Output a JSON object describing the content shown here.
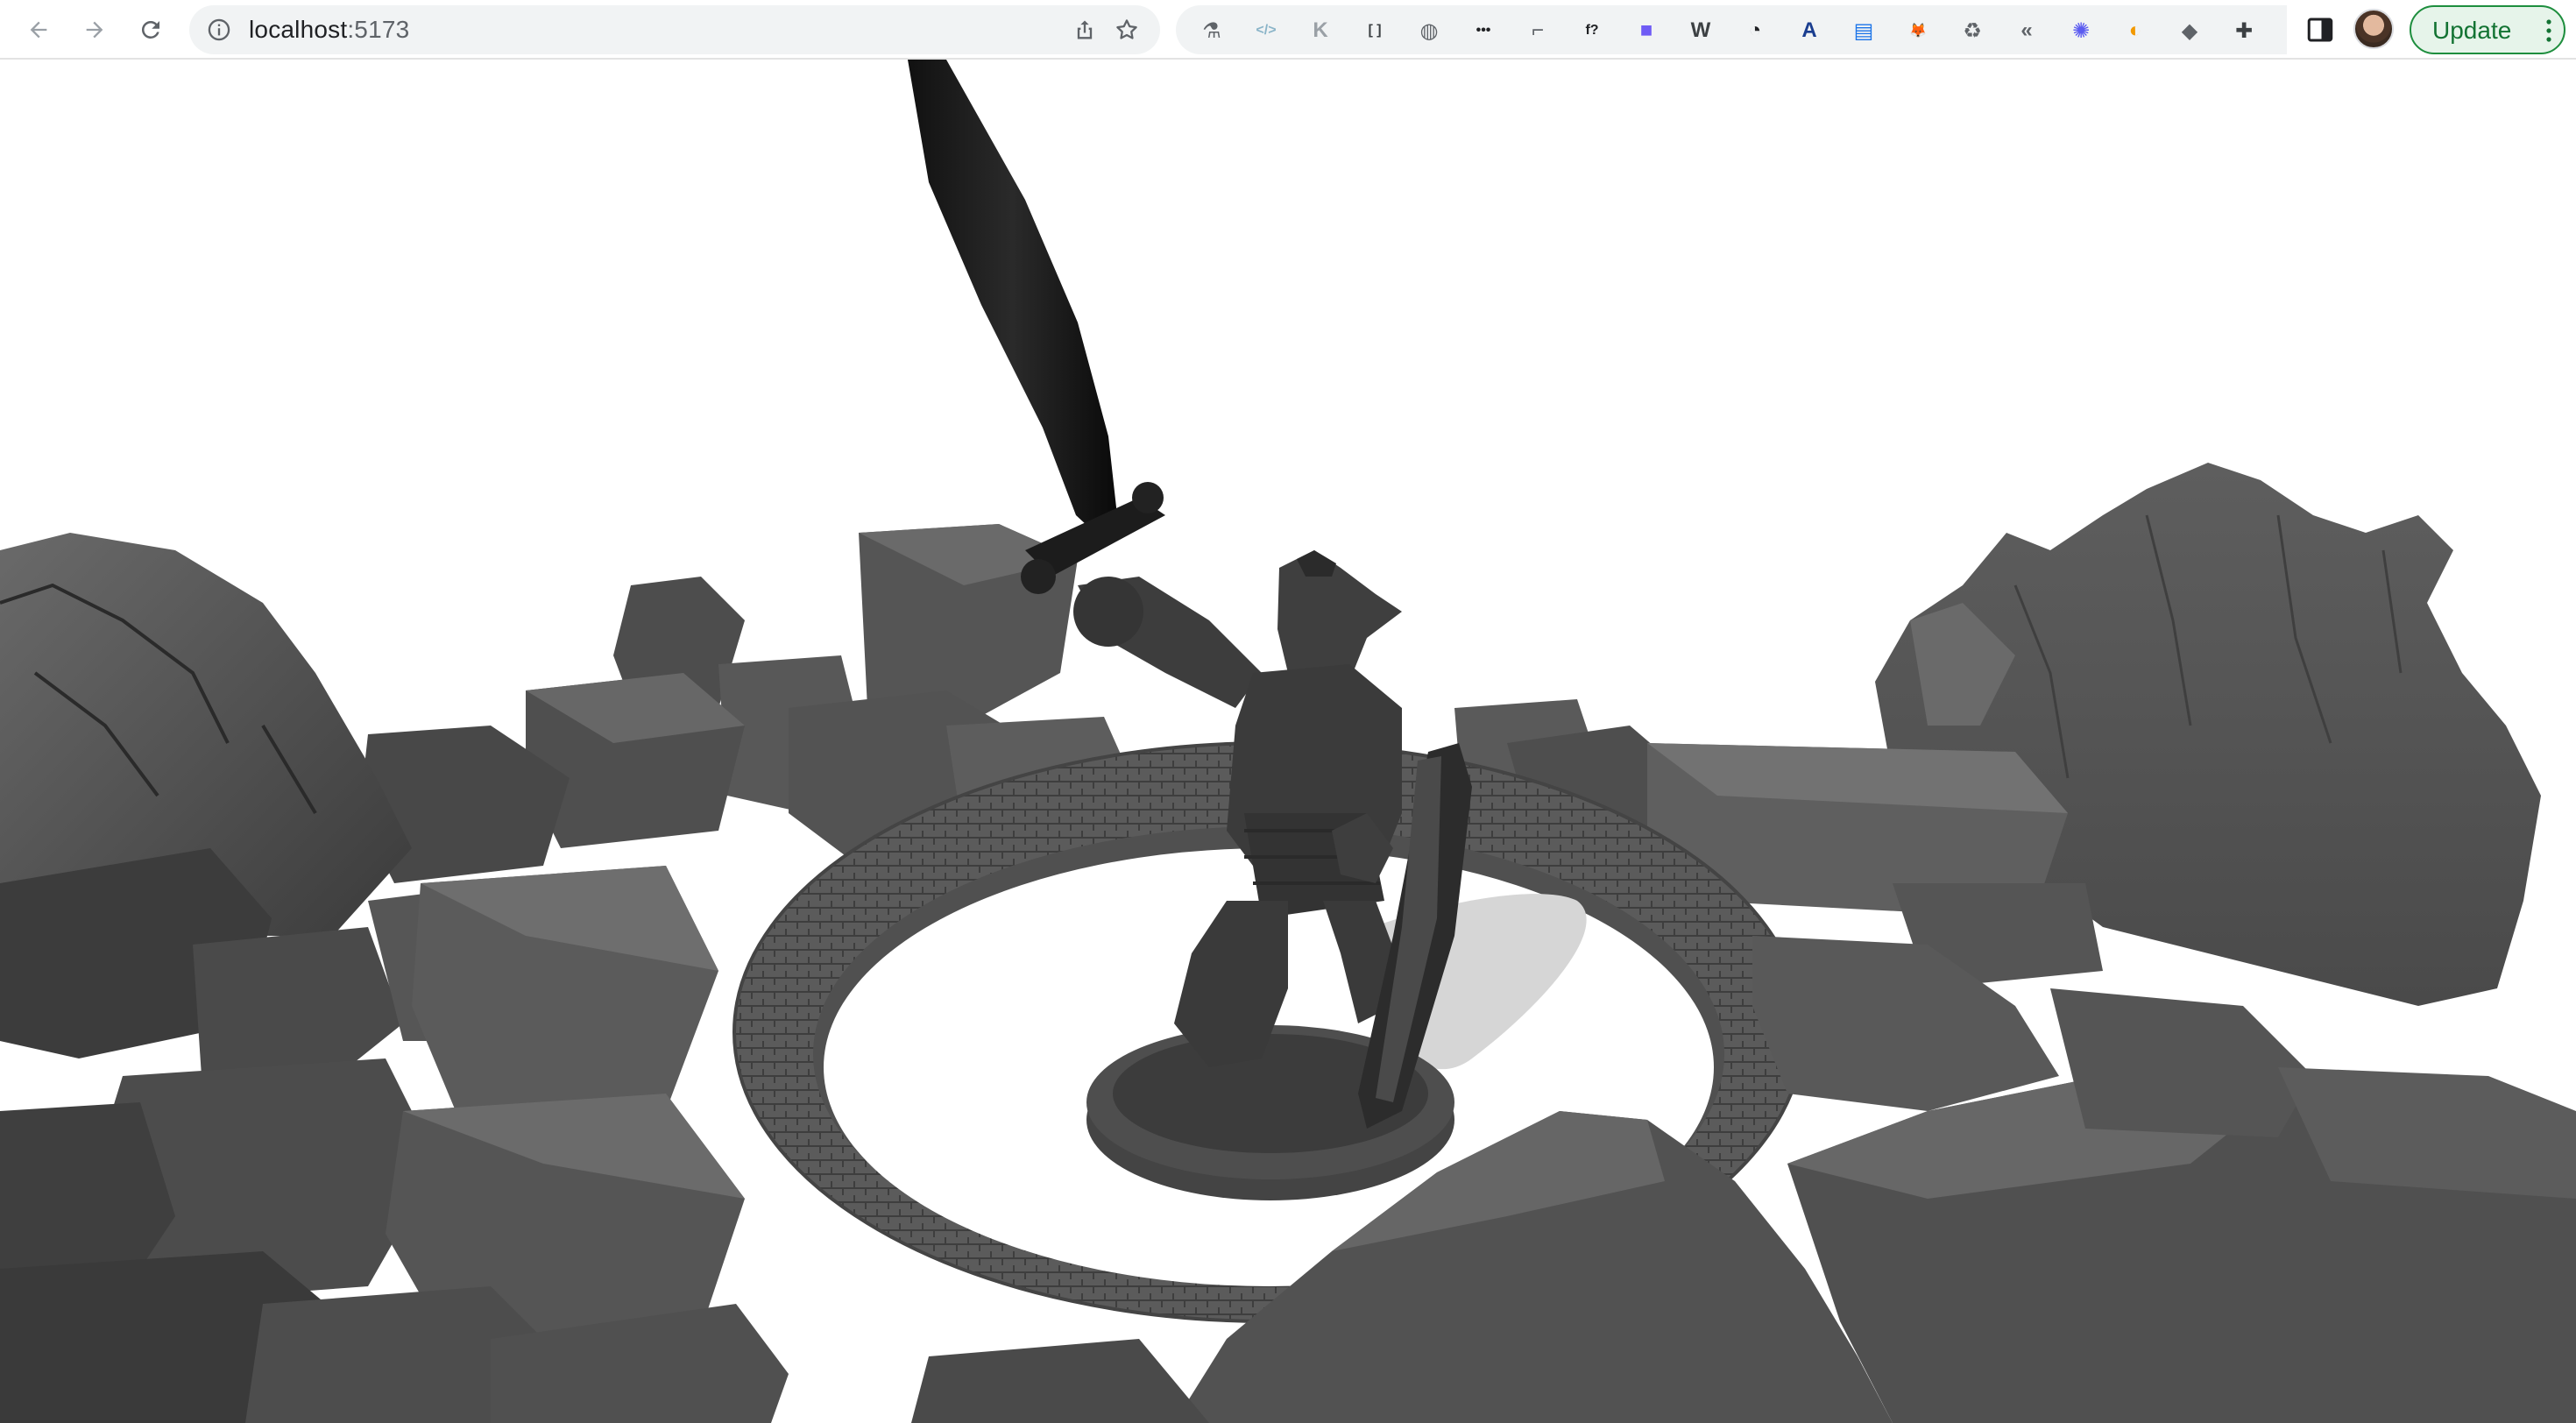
{
  "browser": {
    "url_host": "localhost",
    "url_port": ":5173",
    "nav": {
      "back_icon": "arrow-left-icon",
      "forward_icon": "arrow-right-icon",
      "reload_icon": "reload-icon"
    },
    "omnibox_actions": [
      "share-icon",
      "star-icon"
    ],
    "extensions": [
      {
        "name": "eyedropper-ext-icon",
        "color": "#5f6368",
        "glyph": "⚗"
      },
      {
        "name": "code-ext-icon",
        "color": "#8ab4c8",
        "glyph": "</>"
      },
      {
        "name": "k-ext-icon",
        "color": "#9aa0a6",
        "glyph": "K"
      },
      {
        "name": "screenshot-ext-icon",
        "color": "#3c4043",
        "glyph": "[ ]"
      },
      {
        "name": "globe-ext-icon",
        "color": "#5f6368",
        "glyph": "◍"
      },
      {
        "name": "dots-ext-icon",
        "color": "#202124",
        "glyph": "•••"
      },
      {
        "name": "tool-ext-icon",
        "color": "#5f6368",
        "glyph": "⌐"
      },
      {
        "name": "font-ext-icon",
        "color": "#202124",
        "glyph": "f?"
      },
      {
        "name": "colors-ext-icon",
        "color": "#6f5bf5",
        "glyph": "■"
      },
      {
        "name": "wordpress-ext-icon",
        "color": "#3c4043",
        "glyph": "W"
      },
      {
        "name": "timer-ext-icon",
        "color": "#202124",
        "glyph": "◔"
      },
      {
        "name": "a-circle-ext-icon",
        "color": "#1a3d8f",
        "glyph": "A"
      },
      {
        "name": "tab-ext-icon",
        "color": "#1a73e8",
        "glyph": "▤"
      },
      {
        "name": "fox-ext-icon",
        "color": "#e2761b",
        "glyph": "🦊"
      },
      {
        "name": "recycle-ext-icon",
        "color": "#5f6368",
        "glyph": "♻"
      },
      {
        "name": "c-arrow-ext-icon",
        "color": "#5f6368",
        "glyph": "«"
      },
      {
        "name": "sparkle-ext-icon",
        "color": "#5b5bf0",
        "glyph": "✺"
      },
      {
        "name": "flame-ext-icon",
        "color": "#f29900",
        "glyph": "◐"
      },
      {
        "name": "stack-ext-icon",
        "color": "#5f6368",
        "glyph": "◆"
      },
      {
        "name": "puzzle-ext-icon",
        "color": "#3c4043",
        "glyph": "✚"
      }
    ],
    "update_label": "Update",
    "update_color": "#137333"
  },
  "scene": {
    "background": "#ffffff",
    "rock_color": "#5a5a5a",
    "rock_dark": "#2e2e2e",
    "rock_light": "#6e6e6e",
    "figure_color": "#3a3a3a",
    "shadow_color": "#cfcfcf"
  }
}
